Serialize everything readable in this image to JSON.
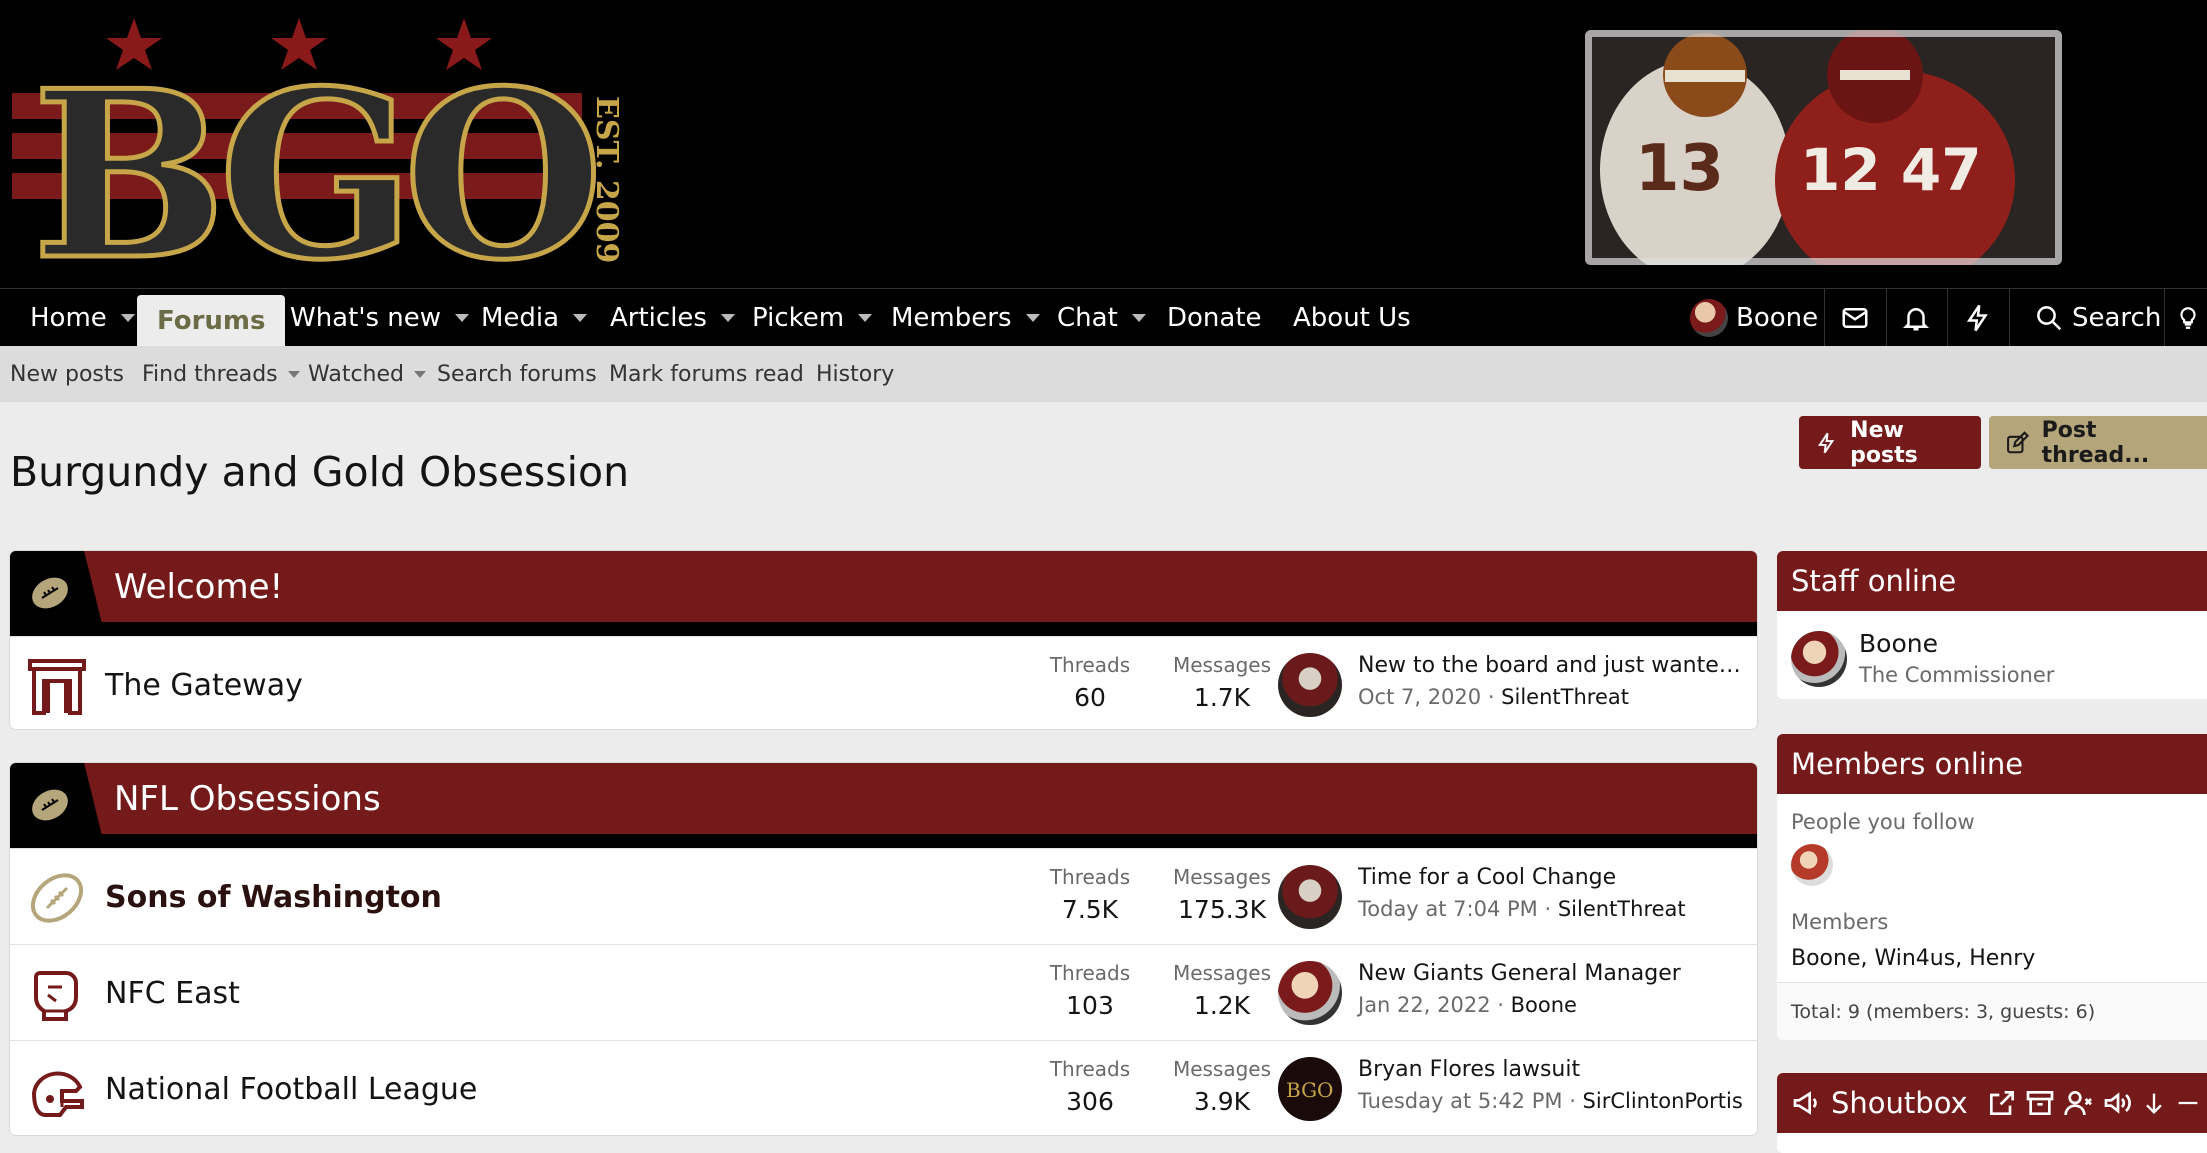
{
  "colors": {
    "burgundy": "#751a1a",
    "gold": "#b5a57a",
    "black": "#000000",
    "page_bg": "#ececec"
  },
  "logo": {
    "text": "BGO",
    "est": "EST. 2009"
  },
  "nav": {
    "items": [
      {
        "label": "Home"
      },
      {
        "label": "Forums"
      },
      {
        "label": "What's new"
      },
      {
        "label": "Media"
      },
      {
        "label": "Articles"
      },
      {
        "label": "Pickem"
      },
      {
        "label": "Members"
      },
      {
        "label": "Chat"
      },
      {
        "label": "Donate"
      },
      {
        "label": "About Us"
      }
    ],
    "user": "Boone",
    "search": "Search"
  },
  "subnav": {
    "items": [
      {
        "label": "New posts"
      },
      {
        "label": "Find threads"
      },
      {
        "label": "Watched"
      },
      {
        "label": "Search forums"
      },
      {
        "label": "Mark forums read"
      },
      {
        "label": "History"
      }
    ]
  },
  "page": {
    "title": "Burgundy and Gold Obsession"
  },
  "actions": {
    "new_posts": "New posts",
    "post_thread": "Post thread..."
  },
  "blocks": [
    {
      "title": "Welcome!",
      "nodes": [
        {
          "title": "The Gateway",
          "threads_label": "Threads",
          "threads": "60",
          "messages_label": "Messages",
          "messages": "1.7K",
          "latest_title": "New to the board and just wanted t...",
          "latest_date": "Oct 7, 2020",
          "latest_user": "SilentThreat"
        }
      ]
    },
    {
      "title": "NFL Obsessions",
      "nodes": [
        {
          "title": "Sons of Washington",
          "threads_label": "Threads",
          "threads": "7.5K",
          "messages_label": "Messages",
          "messages": "175.3K",
          "latest_title": "Time for a Cool Change",
          "latest_date": "Today at 7:04 PM",
          "latest_user": "SilentThreat"
        },
        {
          "title": "NFC East",
          "threads_label": "Threads",
          "threads": "103",
          "messages_label": "Messages",
          "messages": "1.2K",
          "latest_title": "New Giants General Manager",
          "latest_date": "Jan 22, 2022",
          "latest_user": "Boone"
        },
        {
          "title": "National Football League",
          "threads_label": "Threads",
          "threads": "306",
          "messages_label": "Messages",
          "messages": "3.9K",
          "latest_title": "Bryan Flores lawsuit",
          "latest_date": "Tuesday at 5:42 PM",
          "latest_user": "SirClintonPortis"
        }
      ]
    }
  ],
  "sidebar": {
    "staff": {
      "title": "Staff online",
      "name": "Boone",
      "role": "The Commissioner"
    },
    "members": {
      "title": "Members online",
      "follow_label": "People you follow",
      "members_label": "Members",
      "members_list": "Boone, Win4us, Henry",
      "total": "Total: 9 (members: 3, guests: 6)"
    },
    "shoutbox": {
      "title": "Shoutbox"
    }
  }
}
